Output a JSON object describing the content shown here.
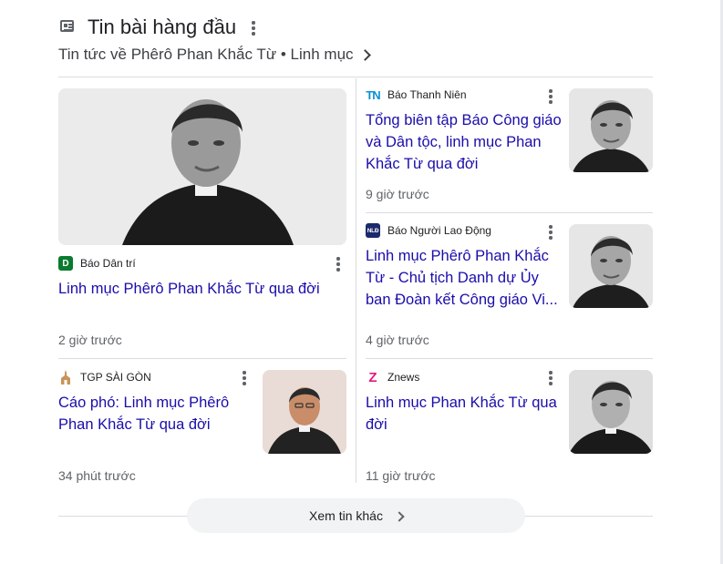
{
  "header": {
    "title": "Tin bài hàng đầu",
    "subtitle": "Tin tức về Phêrô Phan Khắc Từ • Linh mục"
  },
  "articles": [
    {
      "source": "Báo Dân trí",
      "source_logo": "D",
      "headline": "Linh mục Phêrô Phan Khắc Từ qua đời",
      "time": "2 giờ trước"
    },
    {
      "source": "TGP SÀI GÒN",
      "source_logo": "church-icon",
      "headline": "Cáo phó: Linh mục Phêrô Phan Khắc Từ qua đời",
      "time": "34 phút trước"
    },
    {
      "source": "Báo Thanh Niên",
      "source_logo": "TN",
      "headline": "Tổng biên tập Báo Công giáo và Dân tộc, linh mục Phan Khắc Từ qua đời",
      "time": "9 giờ trước"
    },
    {
      "source": "Báo Người Lao Động",
      "source_logo": "NLĐ",
      "headline": "Linh mục Phêrô Phan Khắc Từ - Chủ tịch Danh dự Ủy ban Đoàn kết Công giáo Vi...",
      "time": "4 giờ trước"
    },
    {
      "source": "Znews",
      "source_logo": "Z",
      "headline": "Linh mục Phan Khắc Từ qua đời",
      "time": "11 giờ trước"
    }
  ],
  "more_button": {
    "label": "Xem tin khác"
  },
  "colors": {
    "link": "#1a0dab",
    "dantri_green": "#0a7a2f",
    "thanhnien_blue": "#0a8fd6",
    "nld_navy": "#1b2a6b",
    "znews_pink": "#e4197d"
  }
}
